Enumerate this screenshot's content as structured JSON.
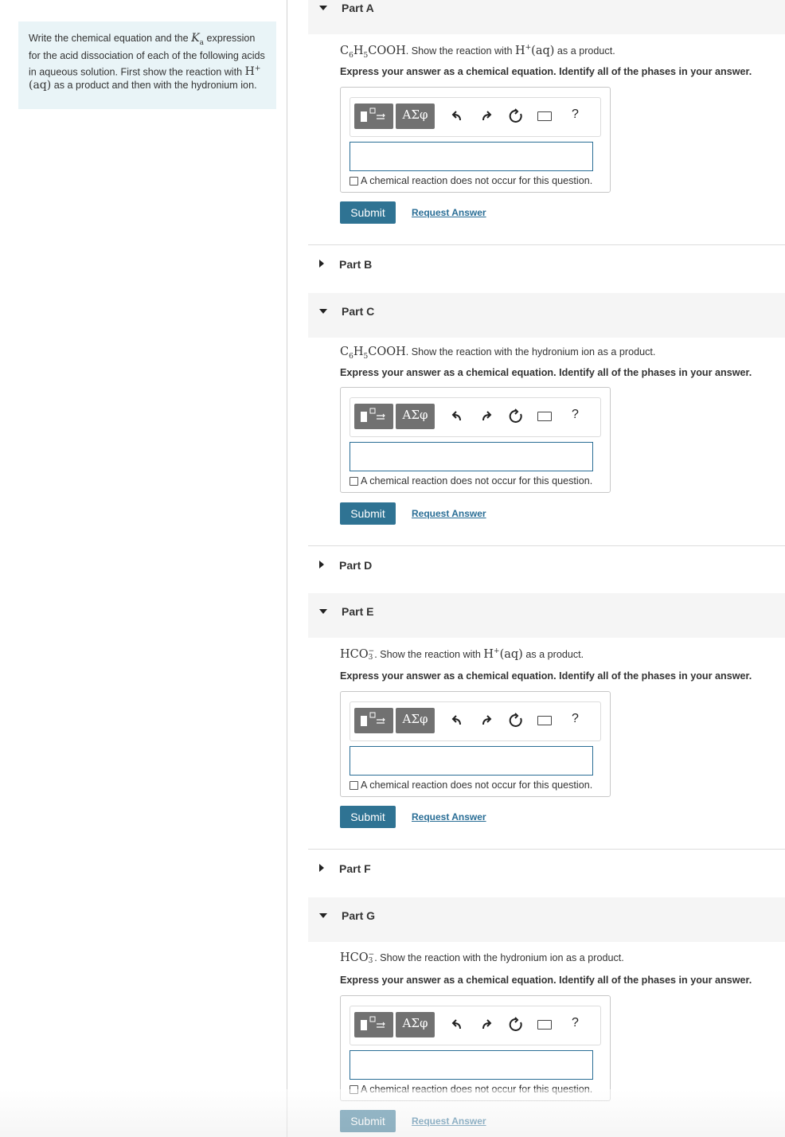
{
  "intro": {
    "text_a": "Write the chemical equation and the ",
    "k": "K",
    "k_sub": "a",
    "text_b": " expression for the acid dissociation of each of the following acids in aqueous solution. First show the reaction with ",
    "h": "H",
    "h_sup": "+",
    "h_aq": "(aq)",
    "text_c": " as a product and then with the hydronium ion."
  },
  "common": {
    "instruction": "Express your answer as a chemical equation. Identify all of the phases in your answer.",
    "no_reaction": "A chemical reaction does not occur for this question.",
    "submit": "Submit",
    "request_answer": "Request Answer",
    "greek_button": "ΑΣφ",
    "help": "?"
  },
  "parts": {
    "a": {
      "title": "Part A",
      "formula_a": "C",
      "sub1": "6",
      "formula_b": "H",
      "sub2": "5",
      "formula_c": "COOH",
      "text1": ". Show the reaction with ",
      "h": "H",
      "h_sup": "+",
      "h_aq": "(aq)",
      "text2": " as a product."
    },
    "b": {
      "title": "Part B"
    },
    "c": {
      "title": "Part C",
      "formula_a": "C",
      "sub1": "6",
      "formula_b": "H",
      "sub2": "5",
      "formula_c": "COOH",
      "text1": ". Show the reaction with the hydronium ion as a product."
    },
    "d": {
      "title": "Part D"
    },
    "e": {
      "title": "Part E",
      "formula": "HCO",
      "sub": "3",
      "sup": "−",
      "text1": ". Show the reaction with ",
      "h": "H",
      "h_sup": "+",
      "h_aq": "(aq)",
      "text2": " as a product."
    },
    "f": {
      "title": "Part F"
    },
    "g": {
      "title": "Part G",
      "formula": "HCO",
      "sub": "3",
      "sup": "−",
      "text1": ". Show the reaction with the hydronium ion as a product."
    }
  }
}
